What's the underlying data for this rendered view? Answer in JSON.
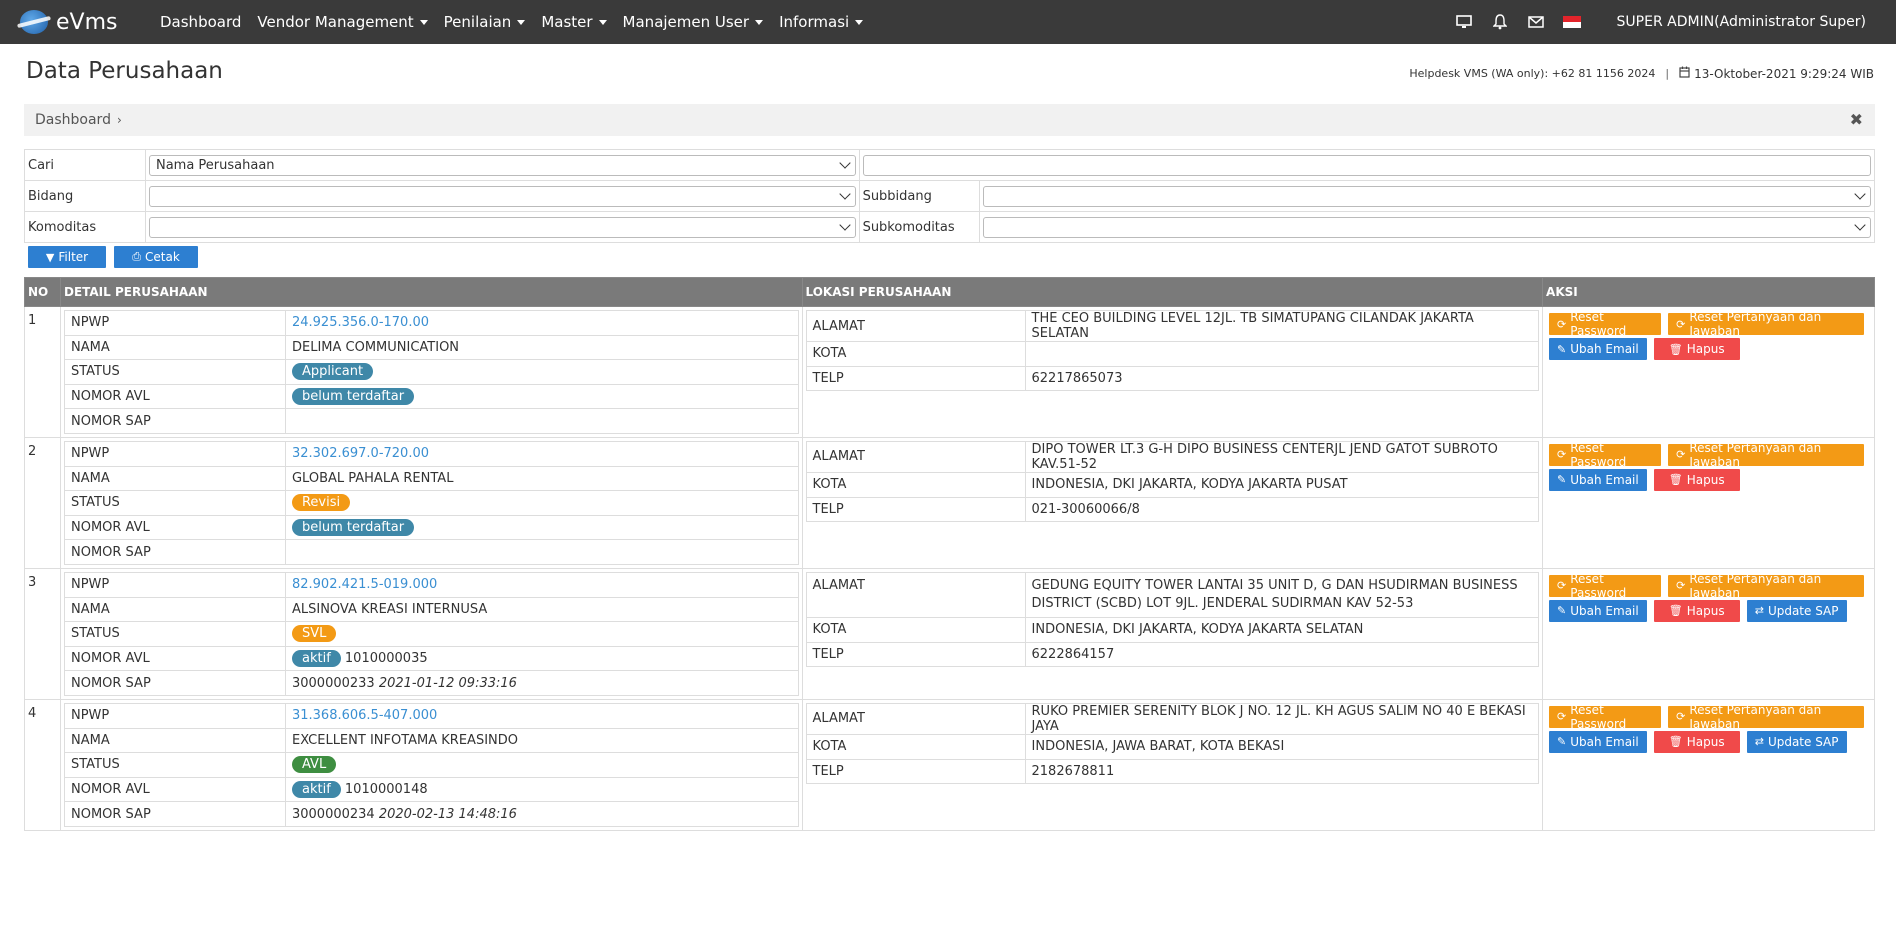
{
  "brand": {
    "name": "eVms"
  },
  "nav": [
    "Dashboard",
    "Vendor Management",
    "Penilaian",
    "Master",
    "Manajemen User",
    "Informasi"
  ],
  "nav_dropdown": [
    false,
    true,
    true,
    true,
    true,
    true
  ],
  "user": {
    "name": "SUPER ADMIN(Administrator Super)"
  },
  "page": {
    "title": "Data Perusahaan",
    "helpdesk": "Helpdesk VMS (WA only): +62 81 1156 2024",
    "datetime": "13-Oktober-2021 9:29:24 WIB"
  },
  "breadcrumb": {
    "label": "Dashboard"
  },
  "filter": {
    "cari_label": "Cari",
    "cari_value": "Nama Perusahaan",
    "bidang_label": "Bidang",
    "subbidang_label": "Subbidang",
    "komoditas_label": "Komoditas",
    "subkomoditas_label": "Subkomoditas",
    "filter_btn": "Filter",
    "cetak_btn": "Cetak"
  },
  "table": {
    "headers": {
      "no": "NO",
      "detail": "DETAIL PERUSAHAAN",
      "lokasi": "LOKASI PERUSAHAAN",
      "aksi": "AKSI"
    },
    "labels": {
      "npwp": "NPWP",
      "nama": "NAMA",
      "status": "STATUS",
      "nomor_avl": "NOMOR AVL",
      "nomor_sap": "NOMOR SAP",
      "alamat": "ALAMAT",
      "kota": "KOTA",
      "telp": "TELP"
    },
    "actions": {
      "reset_password": "Reset Password",
      "reset_pertanyaan": "Reset Pertanyaan dan Jawaban",
      "ubah_email": "Ubah Email",
      "hapus": "Hapus",
      "update_sap": "Update SAP"
    },
    "rows": [
      {
        "no": "1",
        "npwp": "24.925.356.0-170.00",
        "nama": "DELIMA COMMUNICATION",
        "status": "Applicant",
        "status_color": "#3f88a8",
        "avl_badge": "belum terdaftar",
        "avl_number": "",
        "sap_number": "",
        "sap_time": "",
        "alamat": "THE CEO BUILDING LEVEL 12JL. TB SIMATUPANG CILANDAK JAKARTA SELATAN",
        "kota": "",
        "telp": "62217865073",
        "update_sap": false
      },
      {
        "no": "2",
        "npwp": "32.302.697.0-720.00",
        "nama": "GLOBAL PAHALA RENTAL",
        "status": "Revisi",
        "status_color": "#f39a15",
        "avl_badge": "belum terdaftar",
        "avl_number": "",
        "sap_number": "",
        "sap_time": "",
        "alamat": "DIPO TOWER LT.3 G-H DIPO BUSINESS CENTERJL JEND GATOT SUBROTO KAV.51-52",
        "kota": "INDONESIA, DKI JAKARTA, KODYA JAKARTA PUSAT",
        "telp": "021-30060066/8",
        "update_sap": false
      },
      {
        "no": "3",
        "npwp": "82.902.421.5-019.000",
        "nama": "ALSINOVA KREASI INTERNUSA",
        "status": "SVL",
        "status_color": "#f39a15",
        "avl_badge": "aktif",
        "avl_number": "1010000035",
        "sap_number": "3000000233",
        "sap_time": "2021-01-12 09:33:16",
        "alamat": "GEDUNG EQUITY TOWER LANTAI 35 UNIT D, G DAN HSUDIRMAN BUSINESS DISTRICT (SCBD) LOT 9JL. JENDERAL SUDIRMAN KAV 52-53",
        "kota": "INDONESIA, DKI JAKARTA, KODYA JAKARTA SELATAN",
        "telp": "6222864157",
        "update_sap": true
      },
      {
        "no": "4",
        "npwp": "31.368.606.5-407.000",
        "nama": "EXCELLENT INFOTAMA KREASINDO",
        "status": "AVL",
        "status_color": "#3e8e41",
        "avl_badge": "aktif",
        "avl_number": "1010000148",
        "sap_number": "3000000234",
        "sap_time": "2020-02-13 14:48:16",
        "alamat": "RUKO PREMIER SERENITY BLOK J NO. 12 JL. KH AGUS SALIM NO 40 E BEKASI JAYA",
        "kota": "INDONESIA, JAWA BARAT, KOTA BEKASI",
        "telp": "2182678811",
        "update_sap": true
      }
    ]
  }
}
